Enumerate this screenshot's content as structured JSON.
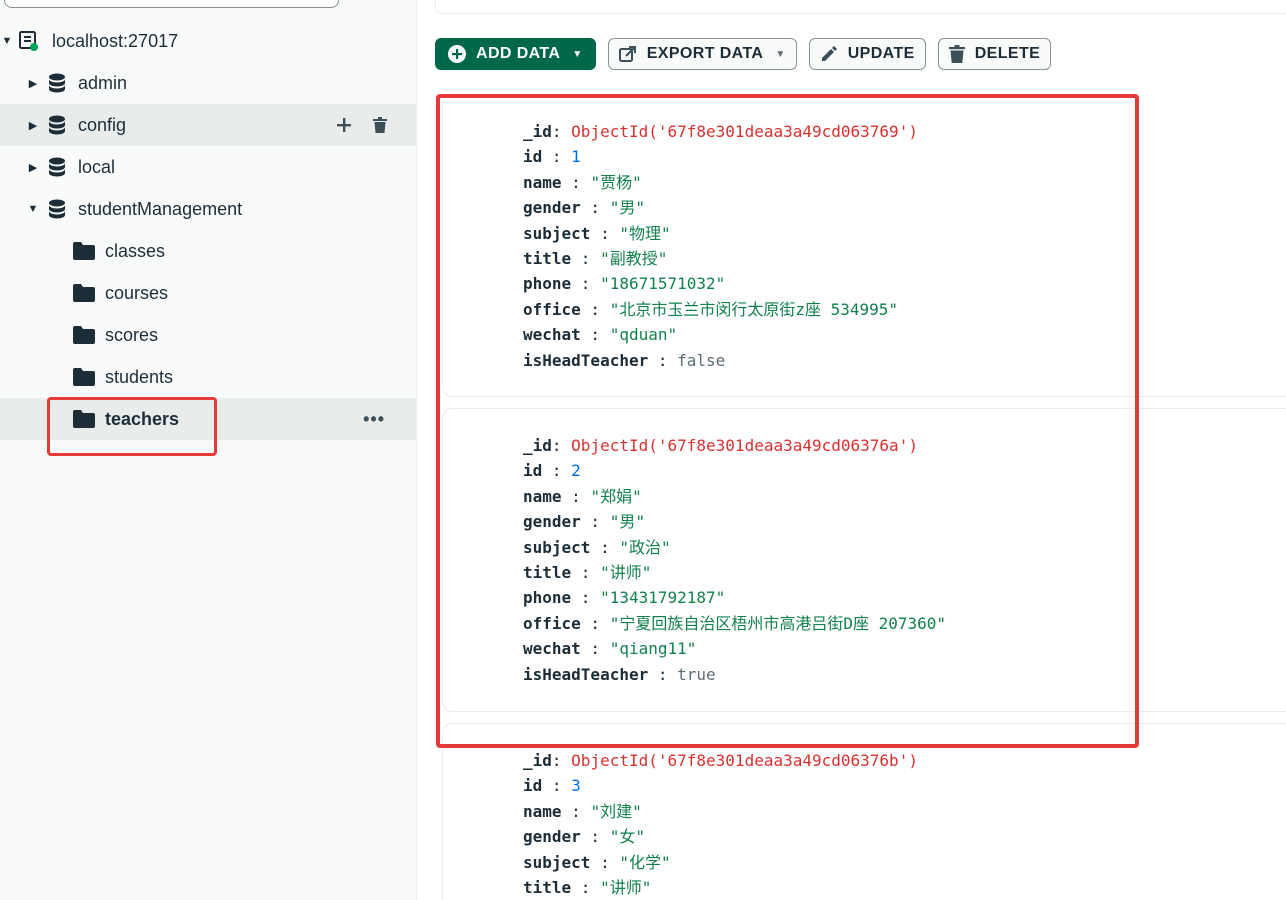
{
  "sidebar": {
    "connection": "localhost:27017",
    "databases": [
      {
        "label": "admin",
        "expanded": false
      },
      {
        "label": "config",
        "expanded": false
      },
      {
        "label": "local",
        "expanded": false
      },
      {
        "label": "studentManagement",
        "expanded": true
      }
    ],
    "collections": [
      "classes",
      "courses",
      "scores",
      "students",
      "teachers"
    ],
    "selected_collection": "teachers"
  },
  "toolbar": {
    "add_data": "ADD DATA",
    "export_data": "EXPORT DATA",
    "update": "UPDATE",
    "delete": "DELETE"
  },
  "documents": [
    {
      "_id": "ObjectId('67f8e301deaa3a49cd063769')",
      "id": "1",
      "name": "\"贾杨\"",
      "gender": "\"男\"",
      "subject": "\"物理\"",
      "title": "\"副教授\"",
      "phone": "\"18671571032\"",
      "office": "\"北京市玉兰市闵行太原街z座 534995\"",
      "wechat": "\"qduan\"",
      "isHeadTeacher": "false"
    },
    {
      "_id": "ObjectId('67f8e301deaa3a49cd06376a')",
      "id": "2",
      "name": "\"郑娟\"",
      "gender": "\"男\"",
      "subject": "\"政治\"",
      "title": "\"讲师\"",
      "phone": "\"13431792187\"",
      "office": "\"宁夏回族自治区梧州市高港吕街D座 207360\"",
      "wechat": "\"qiang11\"",
      "isHeadTeacher": "true"
    },
    {
      "_id": "ObjectId('67f8e301deaa3a49cd06376b')",
      "id": "3",
      "name": "\"刘建\"",
      "gender": "\"女\"",
      "subject": "\"化学\"",
      "title": "\"讲师\""
    }
  ],
  "colors": {
    "brand_green": "#00684a",
    "highlight_red": "#e5393a",
    "string_green": "#12824d",
    "number_blue": "#016bf8",
    "objectid_red": "#db3030"
  }
}
